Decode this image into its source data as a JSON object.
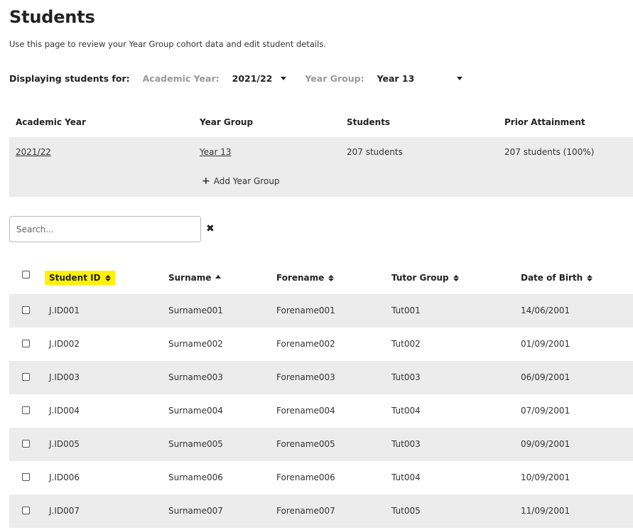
{
  "page": {
    "title": "Students",
    "subtitle": "Use this page to review your Year Group cohort data and edit student details."
  },
  "filters": {
    "lead": "Displaying students for:",
    "academic_year_label": "Academic Year:",
    "academic_year_value": "2021/22",
    "year_group_label": "Year Group:",
    "year_group_value": "Year 13"
  },
  "cohort": {
    "headers": [
      "Academic Year",
      "Year Group",
      "Students",
      "Prior Attainment"
    ],
    "row": {
      "academic_year": "2021/22",
      "year_group": "Year 13",
      "students": "207 students",
      "prior_attainment": "207 students (100%)"
    },
    "add_label": "Add Year Group"
  },
  "search": {
    "placeholder": "Search...",
    "value": ""
  },
  "table": {
    "columns": {
      "student_id": "Student ID",
      "surname": "Surname",
      "forename": "Forename",
      "tutor_group": "Tutor Group",
      "dob": "Date of Birth"
    },
    "rows": [
      {
        "id": "J.ID001",
        "surname": "Surname001",
        "forename": "Forename001",
        "tutor": "Tut001",
        "dob": "14/06/2001"
      },
      {
        "id": "J.ID002",
        "surname": "Surname002",
        "forename": "Forename002",
        "tutor": "Tut002",
        "dob": "01/09/2001"
      },
      {
        "id": "J.ID003",
        "surname": "Surname003",
        "forename": "Forename003",
        "tutor": "Tut003",
        "dob": "06/09/2001"
      },
      {
        "id": "J.ID004",
        "surname": "Surname004",
        "forename": "Forename004",
        "tutor": "Tut004",
        "dob": "07/09/2001"
      },
      {
        "id": "J.ID005",
        "surname": "Surname005",
        "forename": "Forename005",
        "tutor": "Tut003",
        "dob": "09/09/2001"
      },
      {
        "id": "J.ID006",
        "surname": "Surname006",
        "forename": "Forename006",
        "tutor": "Tut004",
        "dob": "10/09/2001"
      },
      {
        "id": "J.ID007",
        "surname": "Surname007",
        "forename": "Forename007",
        "tutor": "Tut005",
        "dob": "11/09/2001"
      }
    ]
  },
  "colors": {
    "highlight": "#fff200",
    "row_shade": "#ececec",
    "muted_label": "#999999"
  },
  "icons": {
    "add": "plus-icon",
    "clear": "close-icon",
    "sort": "sort-icon",
    "sort_asc": "sort-ascending-icon",
    "dropdown": "caret-down-icon"
  }
}
